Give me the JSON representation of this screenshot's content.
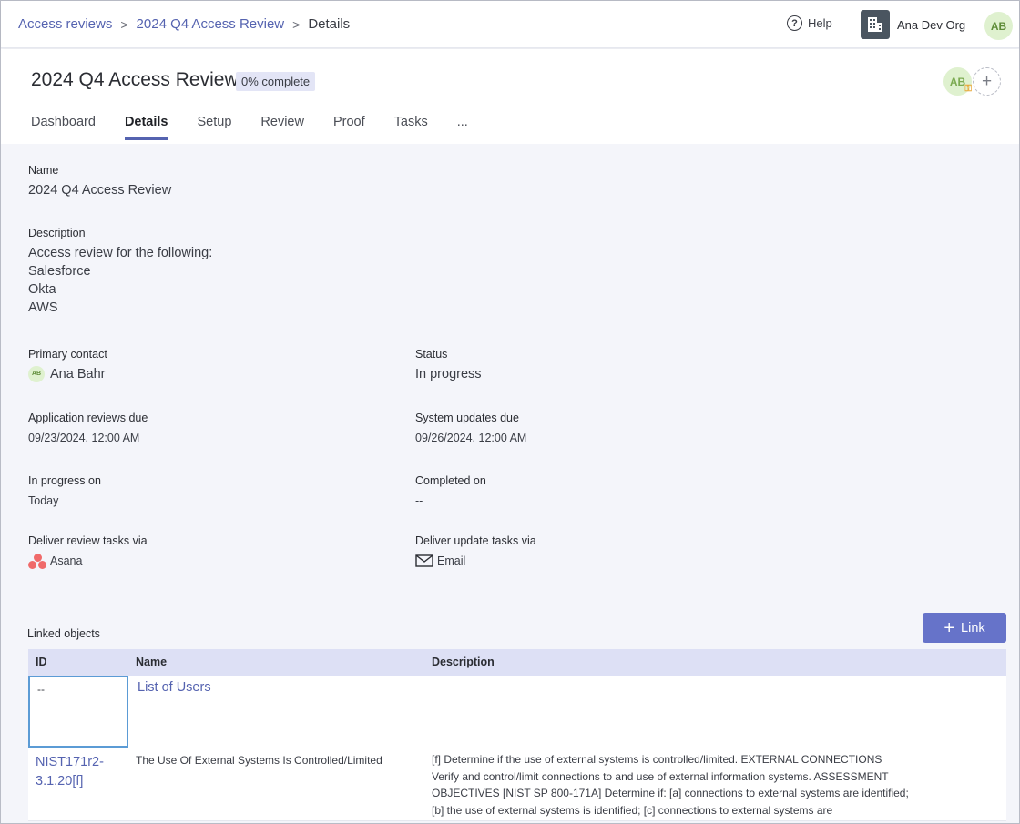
{
  "breadcrumb": {
    "root": "Access reviews",
    "parent": "2024 Q4 Access Review",
    "current": "Details",
    "separator": ">"
  },
  "topbar": {
    "help_label": "Help",
    "org_name": "Ana Dev Org",
    "user_initials": "AB"
  },
  "header": {
    "title": "2024 Q4 Access Review",
    "progress_badge": "0% complete",
    "owner_initials": "AB",
    "add_owner_glyph": "+",
    "tabs": [
      {
        "label": "Dashboard",
        "active": false
      },
      {
        "label": "Details",
        "active": true
      },
      {
        "label": "Setup",
        "active": false
      },
      {
        "label": "Review",
        "active": false
      },
      {
        "label": "Proof",
        "active": false
      },
      {
        "label": "Tasks",
        "active": false
      },
      {
        "label": "...",
        "active": false
      }
    ]
  },
  "details": {
    "name": {
      "label": "Name",
      "value": "2024 Q4 Access Review"
    },
    "description": {
      "label": "Description",
      "lines": [
        "Access review for the following:",
        "Salesforce",
        "Okta",
        "AWS"
      ]
    },
    "primary_contact": {
      "label": "Primary contact",
      "initials": "AB",
      "value": "Ana Bahr"
    },
    "status": {
      "label": "Status",
      "value": "In progress"
    },
    "app_reviews_due": {
      "label": "Application reviews due",
      "value": "09/23/2024, 12:00 AM"
    },
    "system_updates_due": {
      "label": "System updates due",
      "value": "09/26/2024, 12:00 AM"
    },
    "in_progress_on": {
      "label": "In progress on",
      "value": "Today"
    },
    "completed_on": {
      "label": "Completed on",
      "value": "--"
    },
    "deliver_review": {
      "label": "Deliver review tasks via",
      "value": "Asana",
      "icon": "asana-icon"
    },
    "deliver_update": {
      "label": "Deliver update tasks via",
      "value": "Email",
      "icon": "mail-icon"
    }
  },
  "linked_objects": {
    "label": "Linked objects",
    "link_button": "Link",
    "columns": [
      "ID",
      "Name",
      "Description"
    ],
    "rows": [
      {
        "id": "--",
        "name": "List of Users",
        "description": ""
      },
      {
        "id": "NIST171r2-3.1.20[f]",
        "name": "The Use Of External Systems Is Controlled/Limited",
        "description": "[f] Determine if the use of external systems is controlled/limited. EXTERNAL CONNECTIONS Verify and control/limit connections to and use of external information systems. ASSESSMENT OBJECTIVES [NIST SP 800-171A] Determine if: [a] connections to external systems are identified; [b] the use of external systems is identified; [c] connections to external systems are"
      }
    ]
  },
  "colors": {
    "accent": "#5563b0",
    "button": "#6673c9",
    "avatar_bg": "#dff1cf",
    "badge_bg": "#e3e5f6",
    "table_header": "#dde0f5"
  }
}
